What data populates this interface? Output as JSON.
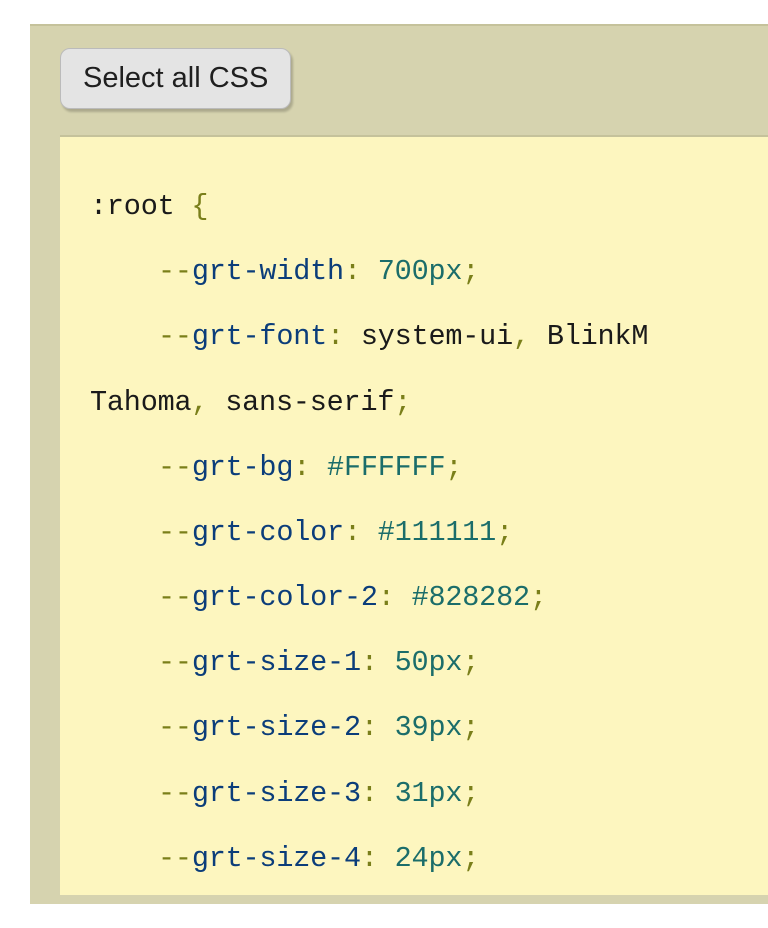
{
  "button": {
    "label": "Select all CSS"
  },
  "css": {
    "selector": ":root",
    "open_brace": "{",
    "props": [
      {
        "name": "grt-width",
        "value": "700px",
        "type": "num"
      },
      {
        "name": "grt-font",
        "value_tokens": [
          {
            "t": "ident",
            "v": "system-ui"
          },
          {
            "t": "comma",
            "v": ", "
          },
          {
            "t": "ident",
            "v": "BlinkM"
          }
        ],
        "wrap_tokens": [
          {
            "t": "ident",
            "v": "Tahoma"
          },
          {
            "t": "comma",
            "v": ", "
          },
          {
            "t": "ident",
            "v": "sans-serif"
          },
          {
            "t": "semi",
            "v": ";"
          }
        ]
      },
      {
        "name": "grt-bg",
        "value": "#FFFFFF",
        "type": "num"
      },
      {
        "name": "grt-color",
        "value": "#111111",
        "type": "num"
      },
      {
        "name": "grt-color-2",
        "value": "#828282",
        "type": "num"
      },
      {
        "name": "grt-size-1",
        "value": "50px",
        "type": "num"
      },
      {
        "name": "grt-size-2",
        "value": "39px",
        "type": "num"
      },
      {
        "name": "grt-size-3",
        "value": "31px",
        "type": "num"
      },
      {
        "name": "grt-size-4",
        "value": "24px",
        "type": "num"
      }
    ]
  }
}
